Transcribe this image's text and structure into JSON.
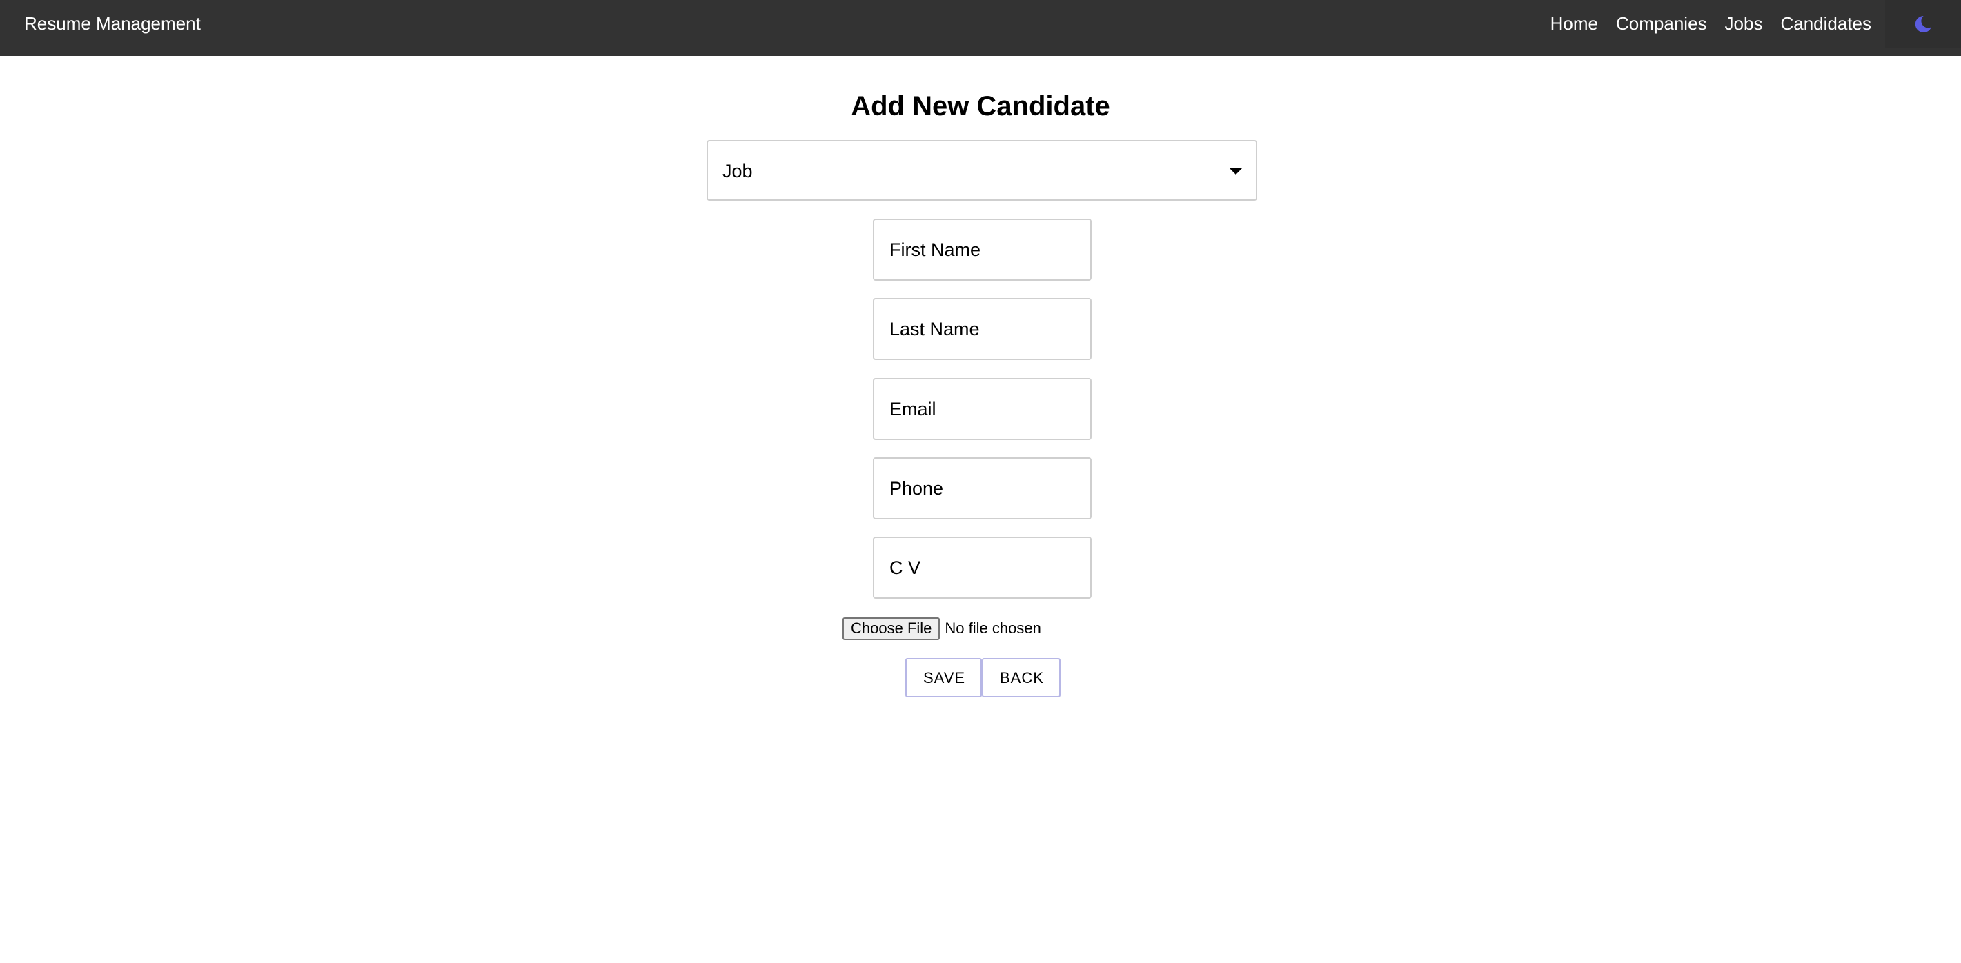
{
  "header": {
    "brand": "Resume Management",
    "nav": [
      "Home",
      "Companies",
      "Jobs",
      "Candidates"
    ],
    "theme_icon": "moon-icon",
    "accent": "#5b5ce0"
  },
  "form": {
    "title": "Add New Candidate",
    "job_select": {
      "label": "Job"
    },
    "fields": {
      "first_name": "First Name",
      "last_name": "Last Name",
      "email": "Email",
      "phone": "Phone",
      "cv": "C V"
    },
    "file": {
      "button": "Choose File",
      "status": "No file chosen"
    },
    "buttons": {
      "save": "SAVE",
      "back": "BACK"
    }
  }
}
